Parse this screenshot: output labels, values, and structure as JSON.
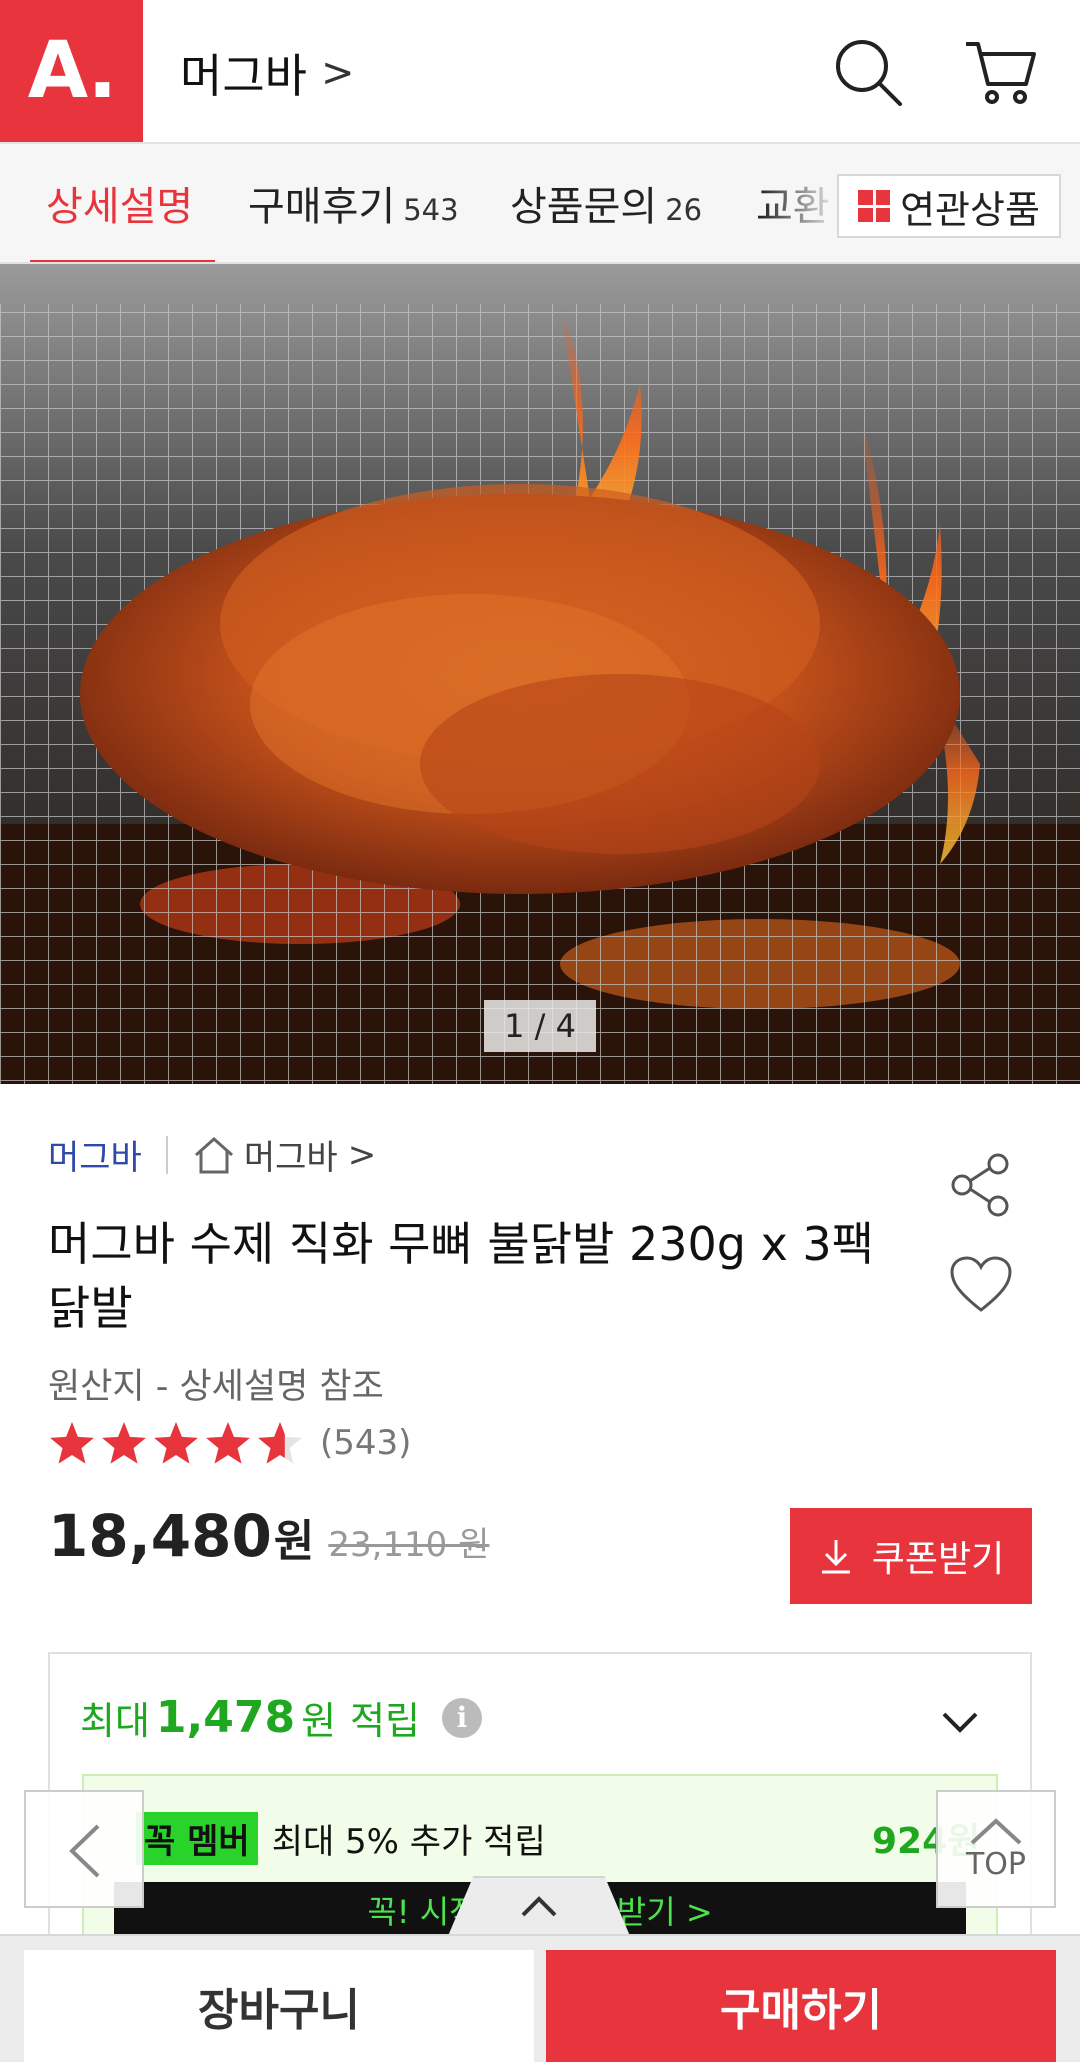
{
  "header": {
    "logo_text": "A.",
    "store_name": "머그바",
    "store_chevron": ">",
    "brand_color": "#e8343d"
  },
  "tabs": {
    "items": [
      {
        "label": "상세설명",
        "count": ""
      },
      {
        "label": "구매후기",
        "count": "543"
      },
      {
        "label": "상품문의",
        "count": "26"
      },
      {
        "label": "교환",
        "count": ""
      }
    ],
    "related_label": "연관상품"
  },
  "gallery": {
    "counter": "1 / 4"
  },
  "product": {
    "seller_link": "머그바",
    "seller_home": "머그바",
    "seller_home_chevron": ">",
    "title": "머그바 수제 직화 무뼈 불닭발 230g x 3팩 닭발",
    "origin": "원산지 - 상세설명 참조",
    "rating_value": 4.6,
    "rating_count": "(543)",
    "price": "18,480",
    "price_unit": "원",
    "original_price": "23,110 원",
    "coupon_label": "쿠폰받기"
  },
  "points": {
    "prefix": "최대",
    "amount": "1,478",
    "unit": "원",
    "suffix": "적립",
    "info_glyph": "i",
    "member_badge": "꼭 멤버",
    "member_text": "최대 5% 추가 적립",
    "member_points": "924원",
    "promo_text": "꼭! 시작하고 혜택 받기  >"
  },
  "floating": {
    "top_label": "TOP"
  },
  "bottom": {
    "cart_label": "장바구니",
    "buy_label": "구매하기"
  }
}
